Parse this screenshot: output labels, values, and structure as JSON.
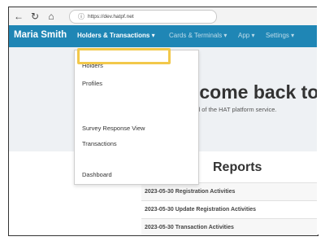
{
  "browser": {
    "url": "https://dev.hatpf.net",
    "icons": {
      "back": "back-icon",
      "reload": "reload-icon",
      "home": "home-icon",
      "lock": "lock-icon"
    }
  },
  "header": {
    "brand": "Maria Smith",
    "nav": [
      {
        "label": "Holders & Transactions ▾",
        "active": true
      },
      {
        "label": "Cards & Terminals ▾"
      },
      {
        "label": "App ▾"
      },
      {
        "label": "Settings ▾"
      }
    ],
    "color": "#1f86b5"
  },
  "dropdown": {
    "items": [
      "Holders",
      "Profiles",
      "Survey Response View",
      "Transactions",
      "Dashboard"
    ],
    "highlight_color": "#f2c84b"
  },
  "hero": {
    "title": "lcome back to",
    "subtitle": "d of the HAT platform service."
  },
  "reports": {
    "title": "Reports",
    "rows": [
      "2023-05-30 Registration Activities",
      "2023-05-30 Update Registration Activities",
      "2023-05-30 Transaction Activities"
    ]
  }
}
